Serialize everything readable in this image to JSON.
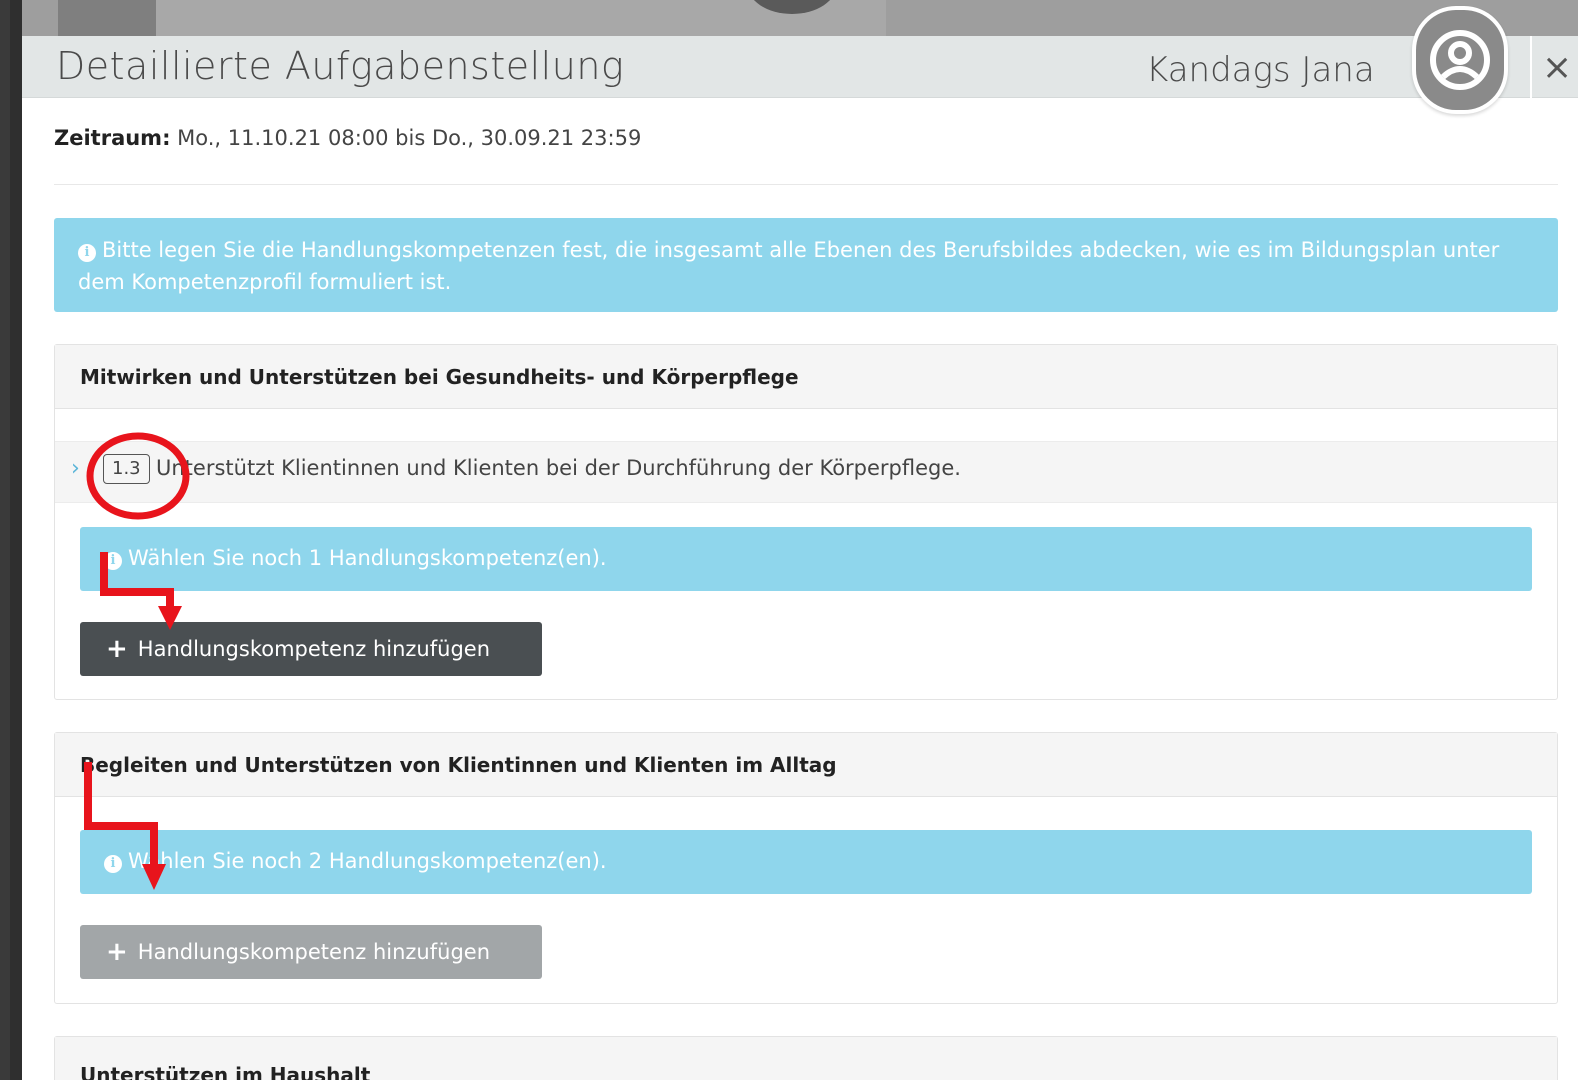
{
  "modal": {
    "title": "Detaillierte Aufgabenstellung",
    "user_name": "Kandags Jana",
    "close_label": "×"
  },
  "period": {
    "label": "Zeitraum:",
    "value": "Mo., 11.10.21 08:00 bis Do., 30.09.21 23:59"
  },
  "info_alert": {
    "icon": "info-circle-icon",
    "text": "Bitte legen Sie die Handlungskompetenzen fest, die insgesamt alle Ebenen des Berufsbildes abdecken, wie es im Bildungsplan unter dem Kompetenzprofil formuliert ist."
  },
  "sections": [
    {
      "title": "Mitwirken und Unterstützen bei Gesundheits- und Körperpflege",
      "competence": {
        "badge": "1.3",
        "text": "Unterstützt Klientinnen und Klienten bei der Durchführung der Körperpflege."
      },
      "alert": "Wählen Sie noch 1 Handlungskompetenz(en).",
      "button": "Handlungskompetenz hinzufügen",
      "button_state": "active"
    },
    {
      "title": "Begleiten und Unterstützen von Klientinnen und Klienten im Alltag",
      "alert": "Wählen Sie noch 2 Handlungskompetenz(en).",
      "button": "Handlungskompetenz hinzufügen",
      "button_state": "disabled"
    },
    {
      "title": "Unterstützen im Haushalt"
    }
  ],
  "colors": {
    "info": "#8fd6ec",
    "button_dark": "#4a4f52",
    "button_disabled": "#a2a6a8",
    "annotation": "#e8141c"
  }
}
